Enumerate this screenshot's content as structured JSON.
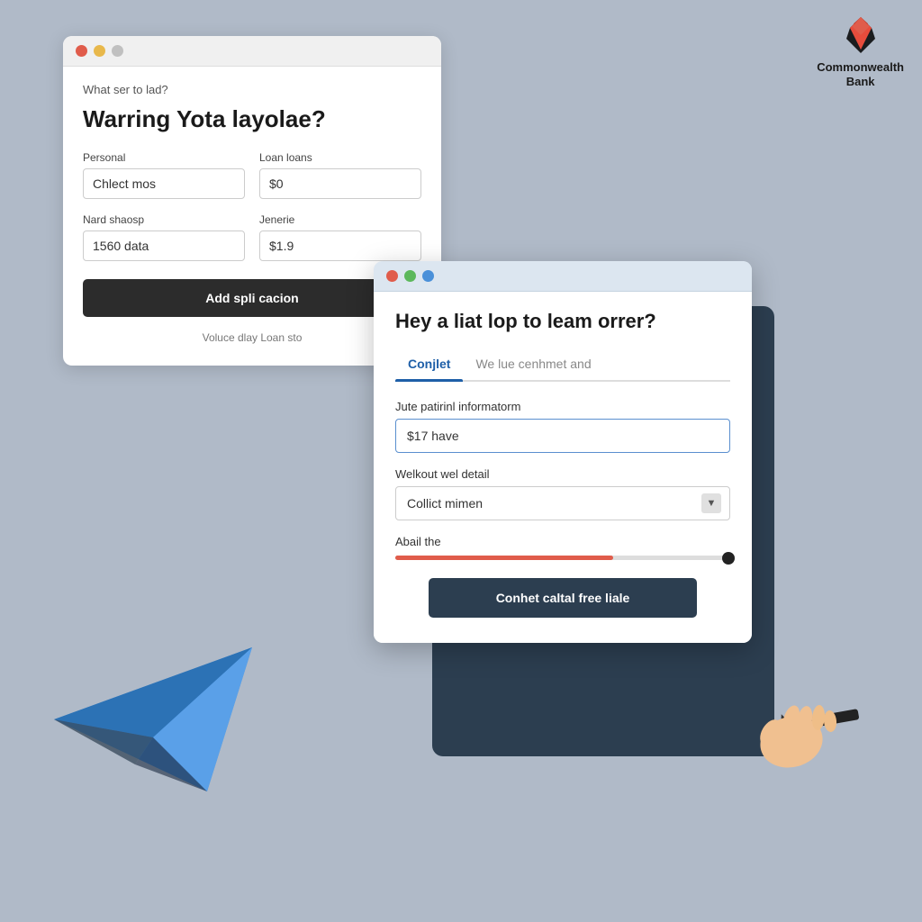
{
  "brand": {
    "name": "Commonwealth Bank",
    "line1": "Commonwealth",
    "line2": "Bank"
  },
  "window_back": {
    "subtitle": "What ser to lad?",
    "title": "Warring Yota layolae?",
    "field1_label": "Personal",
    "field1_value": "Chlect mos",
    "field2_label": "Loan loans",
    "field2_value": "$0",
    "field3_label": "Nard shaosp",
    "field3_value": "1560 data",
    "field4_label": "Jenerie",
    "field4_value": "$1.9",
    "button_label": "Add spli cacion",
    "footer_text": "Voluce dlay Loan sto"
  },
  "window_front": {
    "title": "Hey a liat lop to leam orrer?",
    "tab1": "Conjlet",
    "tab2": "We lue cenhmet and",
    "field1_label": "Jute patirinl informatorm",
    "field1_value": "$17 have",
    "field2_label": "Welkout wel detail",
    "field2_value": "Collict mimen",
    "slider_label": "Abail the",
    "button_label": "Conhet caltal free liale"
  }
}
